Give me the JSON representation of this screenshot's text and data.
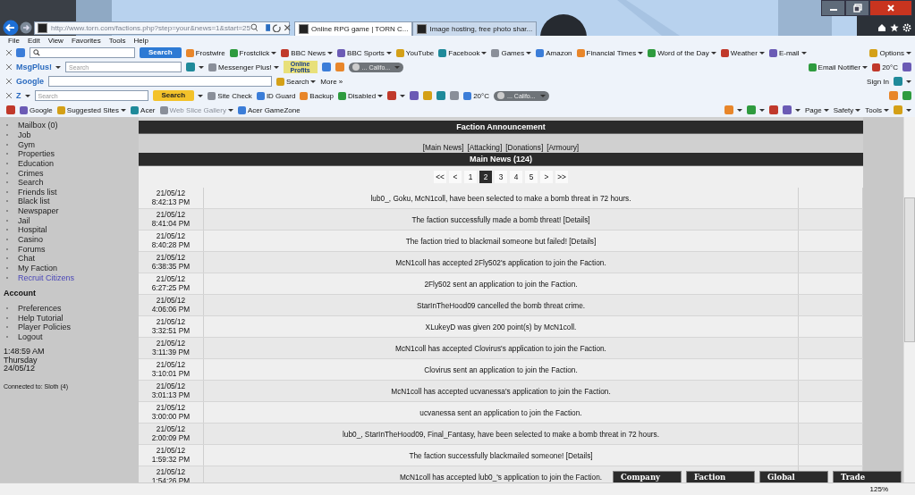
{
  "browser": {
    "address": "http://www.torn.com/factions.php?step=your&news=1&start=25",
    "tabs": [
      {
        "title": "Online RPG game | TORN C...",
        "selected": true
      },
      {
        "title": "Image hosting, free photo shar...",
        "selected": false
      }
    ]
  },
  "menu": [
    "File",
    "Edit",
    "View",
    "Favorites",
    "Tools",
    "Help"
  ],
  "toolbars": [
    {
      "left": [
        {
          "kind": "close"
        },
        {
          "kind": "icon"
        },
        {
          "kind": "searchbox"
        },
        {
          "kind": "button",
          "text": "Search"
        },
        {
          "kind": "link",
          "text": "Frostwire"
        },
        {
          "kind": "link",
          "text": "Frostclick",
          "menu": true
        },
        {
          "kind": "link",
          "text": "BBC News",
          "menu": true
        },
        {
          "kind": "link",
          "text": "BBC Sports",
          "menu": true
        },
        {
          "kind": "link",
          "text": "YouTube"
        },
        {
          "kind": "link",
          "text": "Facebook",
          "menu": true
        },
        {
          "kind": "link",
          "text": "Games",
          "menu": true
        },
        {
          "kind": "link",
          "text": "Amazon"
        },
        {
          "kind": "link",
          "text": "Financial Times",
          "menu": true
        },
        {
          "kind": "link",
          "text": "Word of the Day",
          "menu": true
        },
        {
          "kind": "link",
          "text": "Weather",
          "menu": true
        },
        {
          "kind": "link",
          "text": "E-mail",
          "menu": true
        }
      ],
      "right": [
        {
          "kind": "link",
          "text": "Options",
          "menu": true
        }
      ]
    },
    {
      "left": [
        {
          "kind": "close"
        },
        {
          "kind": "logo",
          "text": "MsgPlus!",
          "menu": true
        },
        {
          "kind": "field",
          "placeholder": "Search"
        },
        {
          "kind": "icon",
          "menu": true
        },
        {
          "kind": "link",
          "text": "Messenger Plus!",
          "menu": true
        },
        {
          "kind": "badge",
          "text": "Online Profits"
        },
        {
          "kind": "icon"
        },
        {
          "kind": "icon"
        },
        {
          "kind": "pill",
          "text": "... Califo..."
        }
      ],
      "right": [
        {
          "kind": "link",
          "text": "Email Notifier",
          "menu": true
        },
        {
          "kind": "link",
          "text": "20°C"
        },
        {
          "kind": "icon"
        }
      ]
    },
    {
      "left": [
        {
          "kind": "close"
        },
        {
          "kind": "logo",
          "text": "Google"
        },
        {
          "kind": "field"
        },
        {
          "kind": "link",
          "text": "Search",
          "menu": true
        },
        {
          "kind": "text",
          "text": "More »"
        }
      ],
      "right": [
        {
          "kind": "text",
          "text": "Sign In"
        },
        {
          "kind": "icon",
          "menu": true
        }
      ]
    },
    {
      "left": [
        {
          "kind": "close"
        },
        {
          "kind": "logo",
          "text": "Z",
          "menu": true
        },
        {
          "kind": "field",
          "placeholder": "Search"
        },
        {
          "kind": "button",
          "text": "Search",
          "menu": true
        },
        {
          "kind": "link",
          "text": "Site Check"
        },
        {
          "kind": "link",
          "text": "ID Guard"
        },
        {
          "kind": "link",
          "text": "Backup"
        },
        {
          "kind": "link",
          "text": "Disabled",
          "menu": true
        },
        {
          "kind": "icon",
          "menu": true
        },
        {
          "kind": "icon"
        },
        {
          "kind": "icon"
        },
        {
          "kind": "icon"
        },
        {
          "kind": "icon"
        },
        {
          "kind": "link",
          "text": "20°C"
        },
        {
          "kind": "pill",
          "text": "... Califo..."
        }
      ],
      "right": [
        {
          "kind": "icon"
        },
        {
          "kind": "icon"
        }
      ]
    }
  ],
  "favorites": {
    "left": [
      {
        "kind": "icon"
      },
      {
        "kind": "link",
        "text": "Google",
        "disabled": false
      },
      {
        "kind": "link",
        "text": "Suggested Sites",
        "menu": true,
        "disabled": false
      },
      {
        "kind": "link",
        "text": "Acer",
        "disabled": false
      },
      {
        "kind": "link",
        "text": "Web Slice Gallery",
        "menu": true,
        "disabled": true
      },
      {
        "kind": "link",
        "text": "Acer GameZone",
        "disabled": false
      }
    ],
    "right": [
      {
        "kind": "icon",
        "menu": true
      },
      {
        "kind": "icon",
        "menu": true
      },
      {
        "kind": "icon"
      },
      {
        "kind": "icon",
        "menu": true
      },
      {
        "kind": "text",
        "text": "Page",
        "menu": true
      },
      {
        "kind": "text",
        "text": "Safety",
        "menu": true
      },
      {
        "kind": "text",
        "text": "Tools",
        "menu": true
      },
      {
        "kind": "icon",
        "menu": true
      }
    ]
  },
  "sidebar": {
    "items": [
      {
        "label": "Mailbox (0)",
        "kind": "item"
      },
      {
        "label": "Job",
        "kind": "item"
      },
      {
        "label": "Gym",
        "kind": "item"
      },
      {
        "label": "Properties",
        "kind": "item"
      },
      {
        "label": "Education",
        "kind": "item"
      },
      {
        "label": "Crimes",
        "kind": "item"
      },
      {
        "label": "Search",
        "kind": "item"
      },
      {
        "label": "Friends list",
        "kind": "item"
      },
      {
        "label": "Black list",
        "kind": "item"
      },
      {
        "label": "Newspaper",
        "kind": "item"
      },
      {
        "label": "Jail",
        "kind": "item"
      },
      {
        "label": "Hospital",
        "kind": "item"
      },
      {
        "label": "Casino",
        "kind": "item"
      },
      {
        "label": "Forums",
        "kind": "item"
      },
      {
        "label": "Chat",
        "kind": "item"
      },
      {
        "label": "My Faction",
        "kind": "item"
      },
      {
        "label": "Recruit Citizens",
        "kind": "link"
      }
    ],
    "account_title": "Account",
    "account_items": [
      "Preferences",
      "Help Tutorial",
      "Player Policies",
      "Logout"
    ],
    "time": "1:48:59 AM",
    "day": "Thursday",
    "date": "24/05/12",
    "connection": "Connected to: Sloth (4)"
  },
  "main": {
    "announcement_title": "Faction Announcement",
    "nav_links": [
      "[Main News]",
      "[Attacking]",
      "[Donations]",
      "[Armoury]"
    ],
    "news_title": "Main News (124)",
    "pages": [
      {
        "label": "<<",
        "selected": false
      },
      {
        "label": "<",
        "selected": false
      },
      {
        "label": "1",
        "selected": false
      },
      {
        "label": "2",
        "selected": true
      },
      {
        "label": "3",
        "selected": false
      },
      {
        "label": "4",
        "selected": false
      },
      {
        "label": "5",
        "selected": false
      },
      {
        "label": ">",
        "selected": false
      },
      {
        "label": ">>",
        "selected": false
      }
    ],
    "rows": [
      {
        "date": "21/05/12",
        "time": "8:42:13 PM",
        "message": "lub0_, Goku, McN1coll, have been selected to make a bomb threat in 72 hours."
      },
      {
        "date": "21/05/12",
        "time": "8:41:04 PM",
        "message": "The faction successfully made a bomb threat! [Details]"
      },
      {
        "date": "21/05/12",
        "time": "8:40:28 PM",
        "message": "The faction tried to blackmail someone but failed! [Details]"
      },
      {
        "date": "21/05/12",
        "time": "6:38:35 PM",
        "message": "McN1coll has accepted 2Fly502's application to join the Faction."
      },
      {
        "date": "21/05/12",
        "time": "6:27:25 PM",
        "message": "2Fly502 sent an application to join the Faction."
      },
      {
        "date": "21/05/12",
        "time": "4:06:06 PM",
        "message": "StarInTheHood09 cancelled the bomb threat crime."
      },
      {
        "date": "21/05/12",
        "time": "3:32:51 PM",
        "message": "XLukeyD was given 200 point(s) by McN1coll."
      },
      {
        "date": "21/05/12",
        "time": "3:11:39 PM",
        "message": "McN1coll has accepted Clovirus's application to join the Faction."
      },
      {
        "date": "21/05/12",
        "time": "3:10:01 PM",
        "message": "Clovirus sent an application to join the Faction."
      },
      {
        "date": "21/05/12",
        "time": "3:01:13 PM",
        "message": "McN1coll has accepted ucvanessa's application to join the Faction."
      },
      {
        "date": "21/05/12",
        "time": "3:00:00 PM",
        "message": "ucvanessa sent an application to join the Faction."
      },
      {
        "date": "21/05/12",
        "time": "2:00:09 PM",
        "message": "lub0_, StarInTheHood09, Final_Fantasy, have been selected to make a bomb threat in 72 hours."
      },
      {
        "date": "21/05/12",
        "time": "1:59:32 PM",
        "message": "The faction successfully blackmailed someone! [Details]"
      },
      {
        "date": "21/05/12",
        "time": "1:54:26 PM",
        "message": "McN1coll has accepted lub0_'s application to join the Faction."
      }
    ]
  },
  "chat_tabs": [
    "Company",
    "Faction",
    "Global",
    "Trade"
  ],
  "status_bar": {
    "zoom": "125%"
  }
}
